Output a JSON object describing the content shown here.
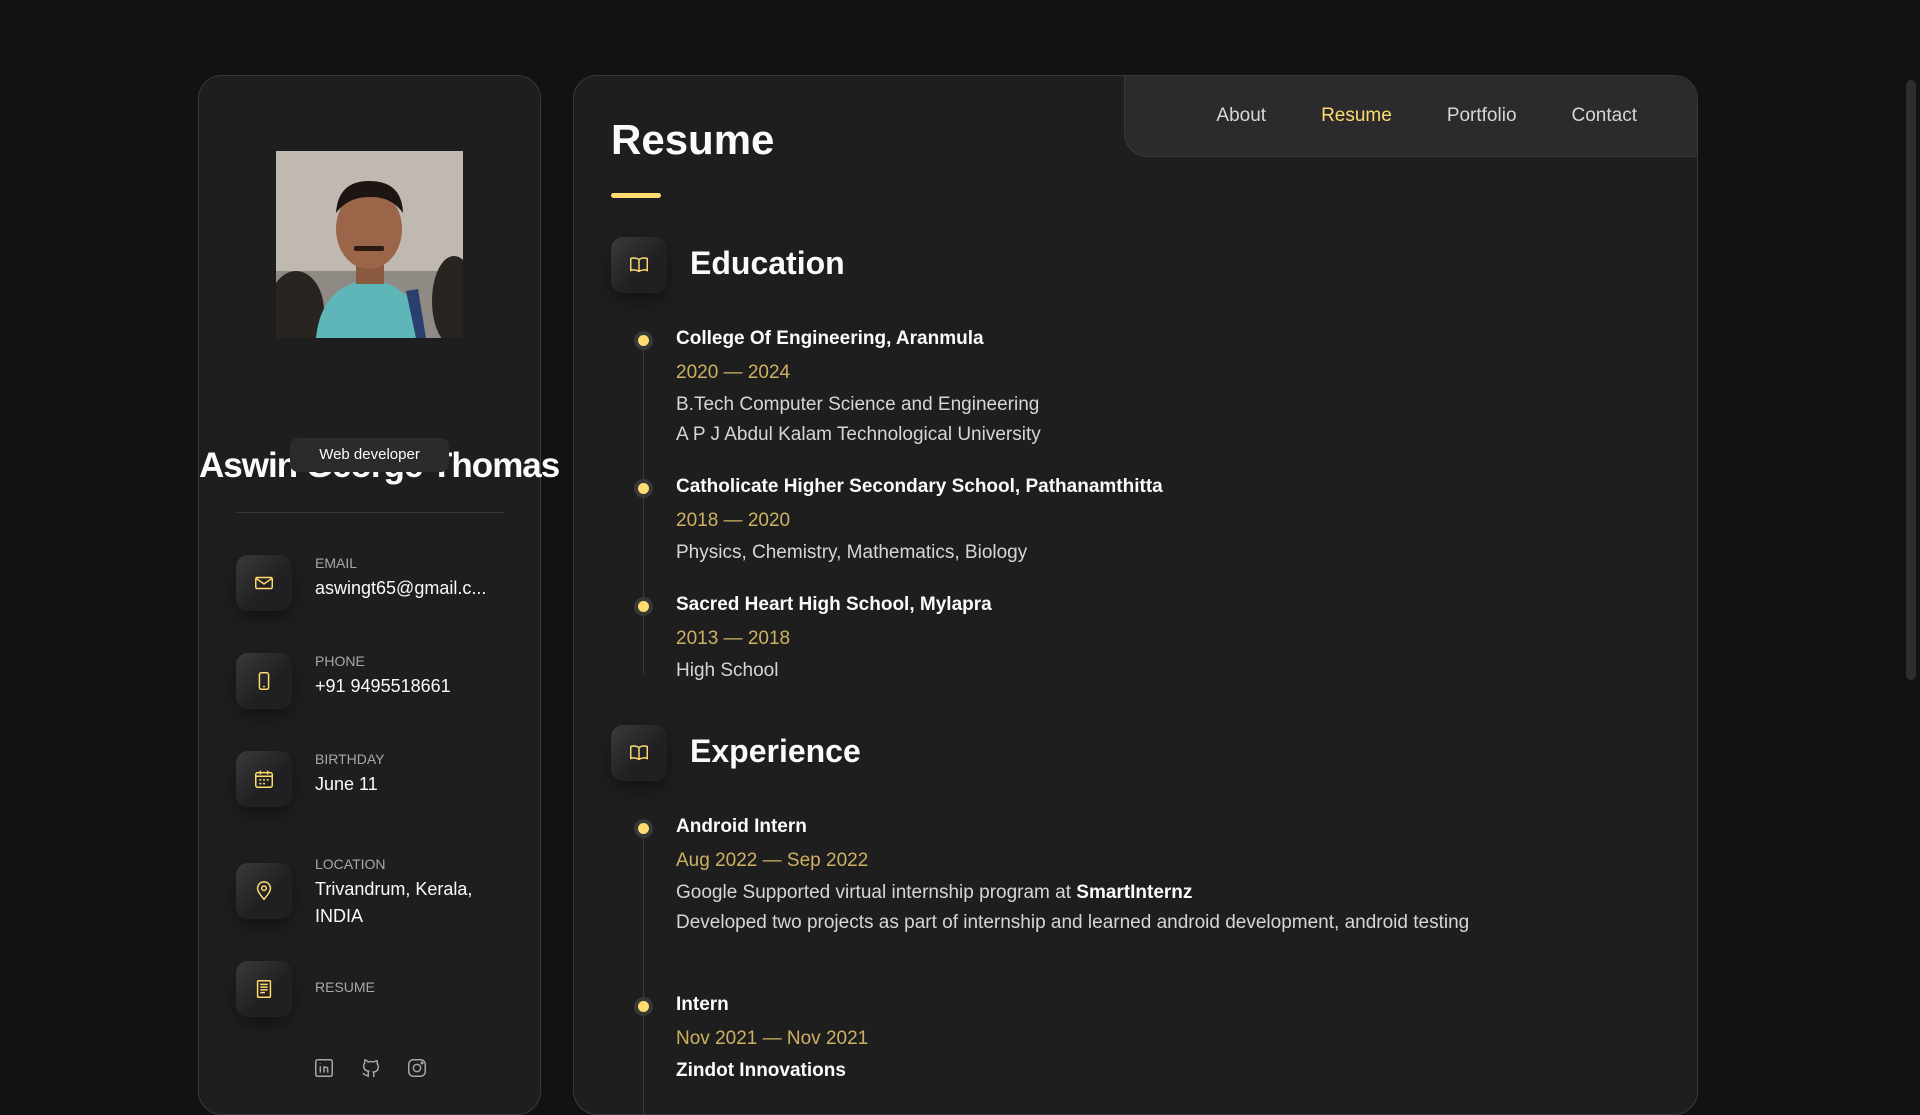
{
  "sidebar": {
    "name": "Aswin George Thomas",
    "title": "Web developer",
    "avatar_alt": "Profile photo",
    "contacts": [
      {
        "label": "Email",
        "value": "aswingt65@gmail.c...",
        "icon": "mail-icon"
      },
      {
        "label": "Phone",
        "value": "+91 9495518661",
        "icon": "phone-icon"
      },
      {
        "label": "Birthday",
        "value": "June 11",
        "icon": "calendar-icon"
      },
      {
        "label": "Location",
        "value": "Trivandrum, Kerala, INDIA",
        "icon": "location-pin-icon"
      },
      {
        "label": "Resume",
        "value": "",
        "icon": "document-icon"
      }
    ],
    "socials": [
      "linkedin-icon",
      "github-icon",
      "instagram-icon"
    ]
  },
  "nav": {
    "items": [
      "About",
      "Resume",
      "Portfolio",
      "Contact"
    ],
    "active": "Resume"
  },
  "page": {
    "title": "Resume"
  },
  "education": {
    "heading": "Education",
    "items": [
      {
        "title": "College Of Engineering, Aranmula",
        "date": "2020 — 2024",
        "lines": [
          "B.Tech Computer Science and Engineering",
          "A P J Abdul Kalam Technological University"
        ]
      },
      {
        "title": "Catholicate Higher Secondary School, Pathanamthitta",
        "date": "2018 — 2020",
        "lines": [
          "Physics, Chemistry, Mathematics, Biology"
        ]
      },
      {
        "title": "Sacred Heart High School, Mylapra",
        "date": "2013 — 2018",
        "lines": [
          "High School"
        ]
      }
    ]
  },
  "experience": {
    "heading": "Experience",
    "items": [
      {
        "title": "Android Intern",
        "date": "Aug 2022 — Sep 2022",
        "line1_prefix": "Google Supported virtual internship program at ",
        "line1_bold": "SmartInternz",
        "line2": "Developed two projects as part of internship and learned android development, android testing"
      },
      {
        "title": "Intern",
        "date": "Nov 2021 — Nov 2021",
        "company": "Zindot Innovations"
      }
    ]
  },
  "colors": {
    "accent": "#ffdb70",
    "background": "#121212",
    "card": "#1e1e1f"
  }
}
